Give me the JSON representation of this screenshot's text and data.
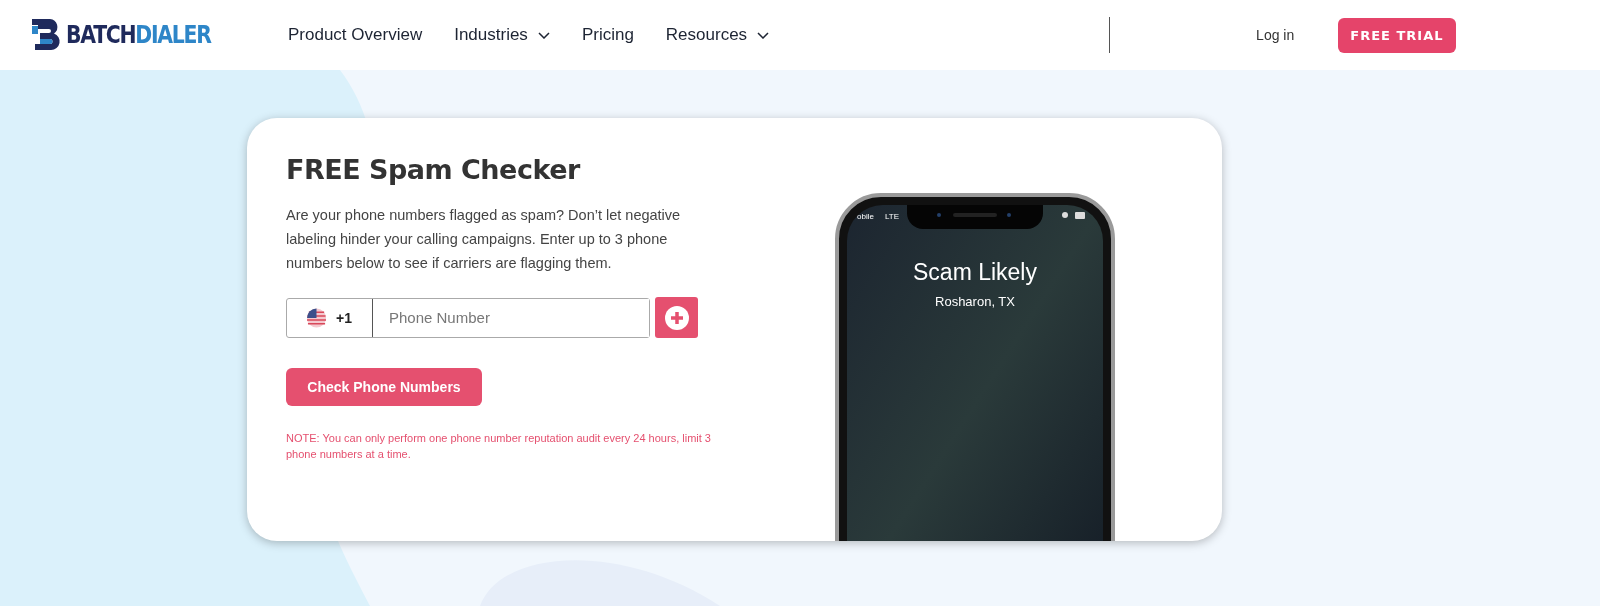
{
  "header": {
    "logo": {
      "part1": "BATCH",
      "part2": "DIALER"
    },
    "nav": [
      {
        "label": "Product Overview",
        "has_dropdown": false
      },
      {
        "label": "Industries",
        "has_dropdown": true
      },
      {
        "label": "Pricing",
        "has_dropdown": false
      },
      {
        "label": "Resources",
        "has_dropdown": true
      }
    ],
    "login": "Log in",
    "cta": "FREE TRIAL"
  },
  "checker": {
    "title": "FREE Spam Checker",
    "description": "Are your phone numbers flagged as spam? Don’t let negative labeling hinder your calling campaigns. Enter up to 3 phone numbers below to see if carriers are flagging them.",
    "country_code": "+1",
    "phone_field": {
      "placeholder": "Phone Number"
    },
    "submit": "Check Phone Numbers",
    "note": "NOTE: You can only perform one phone number reputation audit every 24 hours, limit 3 phone numbers at a time."
  },
  "phone": {
    "carrier": "obile",
    "network": "LTE",
    "caller": "Scam Likely",
    "location": "Rosharon, TX"
  }
}
